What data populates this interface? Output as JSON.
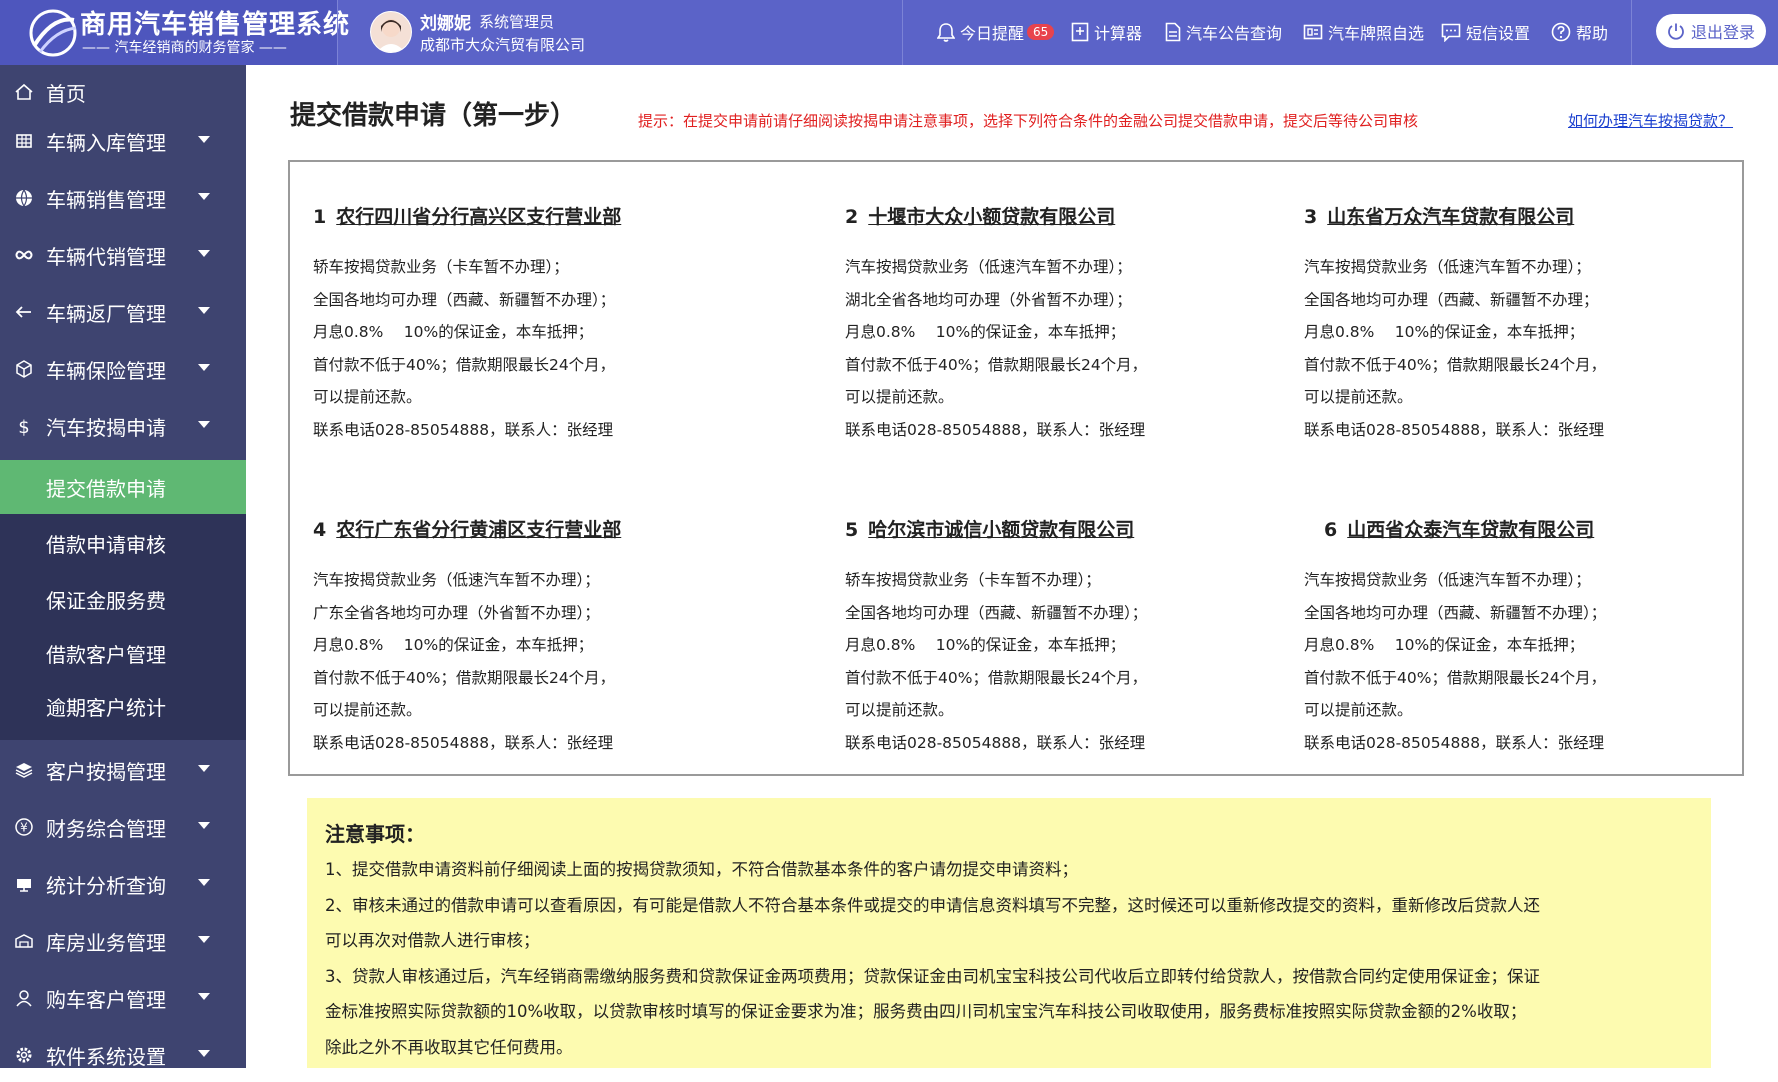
{
  "app": {
    "title": "商用汽车销售管理系统",
    "subtitle": "—— 汽车经销商的财务管家 ——"
  },
  "user": {
    "name": "刘娜妮",
    "role": "系统管理员",
    "company": "成都市大众汽贸有限公司"
  },
  "nav": {
    "reminder_label": "今日提醒",
    "reminder_count": "65",
    "calculator": "计算器",
    "announcement": "汽车公告查询",
    "plate": "汽车牌照自选",
    "sms": "短信设置",
    "help": "帮助",
    "logout": "退出登录"
  },
  "sidebar": {
    "items": [
      {
        "label": "首页",
        "icon": "home-icon"
      },
      {
        "label": "车辆入库管理",
        "icon": "grid-icon"
      },
      {
        "label": "车辆销售管理",
        "icon": "globe-icon"
      },
      {
        "label": "车辆代销管理",
        "icon": "infinity-icon"
      },
      {
        "label": "车辆返厂管理",
        "icon": "arrow-left-icon"
      },
      {
        "label": "车辆保险管理",
        "icon": "cube-icon"
      },
      {
        "label": "汽车按揭申请",
        "icon": "dollar-icon"
      },
      {
        "label": "客户按揭管理",
        "icon": "layers-icon"
      },
      {
        "label": "财务综合管理",
        "icon": "yen-icon"
      },
      {
        "label": "统计分析查询",
        "icon": "chart-icon"
      },
      {
        "label": "库房业务管理",
        "icon": "warehouse-icon"
      },
      {
        "label": "购车客户管理",
        "icon": "user-icon"
      },
      {
        "label": "软件系统设置",
        "icon": "gear-icon"
      }
    ],
    "sub_items": [
      {
        "label": "提交借款申请",
        "active": true
      },
      {
        "label": "借款申请审核"
      },
      {
        "label": "保证金服务费"
      },
      {
        "label": "借款客户管理"
      },
      {
        "label": "逾期客户统计"
      }
    ]
  },
  "page": {
    "title": "提交借款申请（第一步）",
    "hint": "提示：在提交申请前请仔细阅读按揭申请注意事项，选择下列符合条件的金融公司提交借款申请，提交后等待公司审核",
    "howto_link": "如何办理汽车按揭贷款？"
  },
  "lenders": [
    {
      "num": "1",
      "name": "农行四川省分行高兴区支行营业部",
      "lines": [
        "轿车按揭贷款业务（卡车暂不办理）；",
        "全国各地均可办理（西藏、新疆暂不办理）；",
        "月息0.8%　 10%的保证金，本车抵押；",
        "首付款不低于40%；借款期限最长24个月，",
        "可以提前还款。",
        "联系电话028-85054888，联系人：张经理"
      ]
    },
    {
      "num": "2",
      "name": "十堰市大众小额贷款有限公司",
      "lines": [
        "汽车按揭贷款业务（低速汽车暂不办理）；",
        "湖北全省各地均可办理（外省暂不办理）；",
        "月息0.8%　 10%的保证金，本车抵押；",
        "首付款不低于40%；借款期限最长24个月，",
        "可以提前还款。",
        "联系电话028-85054888，联系人：张经理"
      ]
    },
    {
      "num": "3",
      "name": "山东省万众汽车贷款有限公司",
      "lines": [
        "汽车按揭贷款业务（低速汽车暂不办理）；",
        "全国各地均可办理（西藏、新疆暂不办理；",
        "月息0.8%　 10%的保证金，本车抵押；",
        "首付款不低于40%；借款期限最长24个月，",
        "可以提前还款。",
        "联系电话028-85054888，联系人：张经理"
      ]
    },
    {
      "num": "4",
      "name": "农行广东省分行黄浦区支行营业部",
      "lines": [
        "汽车按揭贷款业务（低速汽车暂不办理）；",
        "广东全省各地均可办理（外省暂不办理）；",
        "月息0.8%　 10%的保证金，本车抵押；",
        "首付款不低于40%；借款期限最长24个月，",
        "可以提前还款。",
        "联系电话028-85054888，联系人：张经理"
      ]
    },
    {
      "num": "5",
      "name": "哈尔滨市诚信小额贷款有限公司",
      "lines": [
        "轿车按揭贷款业务（卡车暂不办理）；",
        "全国各地均可办理（西藏、新疆暂不办理）；",
        "月息0.8%　 10%的保证金，本车抵押；",
        "首付款不低于40%；借款期限最长24个月，",
        "可以提前还款。",
        "联系电话028-85054888，联系人：张经理"
      ]
    },
    {
      "num": "6",
      "name": "山西省众泰汽车贷款有限公司",
      "lines": [
        "汽车按揭贷款业务（低速汽车暂不办理）；",
        "全国各地均可办理（西藏、新疆暂不办理）；",
        "月息0.8%　 10%的保证金，本车抵押；",
        "首付款不低于40%；借款期限最长24个月，",
        "可以提前还款。",
        "联系电话028-85054888，联系人：张经理"
      ]
    }
  ],
  "notice": {
    "title": "注意事项：",
    "lines": [
      "1、提交借款申请资料前仔细阅读上面的按揭贷款须知，不符合借款基本条件的客户请勿提交申请资料；",
      "2、审核未通过的借款申请可以查看原因，有可能是借款人不符合基本条件或提交的申请信息资料填写不完整，这时候还可以重新修改提交的资料，重新修改后贷款人还",
      "可以再次对借款人进行审核；",
      "3、贷款人审核通过后，汽车经销商需缴纳服务费和贷款保证金两项费用；贷款保证金由司机宝宝科技公司代收后立即转付给贷款人，按借款合同约定使用保证金；保证",
      "金标准按照实际贷款额的10%收取，以贷款审核时填写的保证金要求为准；服务费由四川司机宝宝汽车科技公司收取使用，服务费标准按照实际贷款金额的2%收取；",
      "除此之外不再收取其它任何费用。"
    ]
  },
  "colors": {
    "topbar": "#5b63c8",
    "sidebar": "#3e4470",
    "submenu": "#2e3358",
    "active": "#5fb873",
    "hint": "#e02020",
    "notice_bg": "#fdfbb0"
  }
}
